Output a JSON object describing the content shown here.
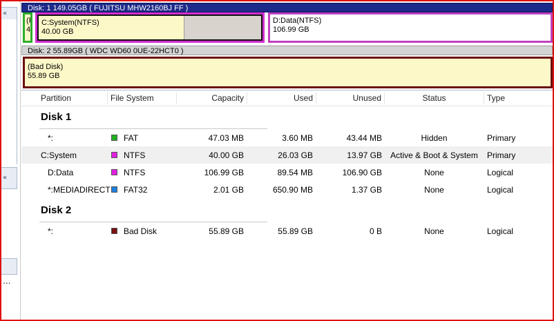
{
  "disk1": {
    "header": "Disk: 1 149.05GB  ( FUJITSU MHW2160BJ FF )",
    "partitions": {
      "fat": {
        "label": "(F",
        "size": "4"
      },
      "c_system": {
        "label": "C:System(NTFS)",
        "size": "40.00 GB"
      },
      "d_data": {
        "label": "D:Data(NTFS)",
        "size": "106.99 GB"
      }
    }
  },
  "disk2": {
    "header": "Disk: 2 55.89GB  ( WDC WD60 0UE-22HCT0 )",
    "partitions": {
      "bad": {
        "label": "(Bad Disk)",
        "size": "55.89 GB"
      }
    }
  },
  "table": {
    "columns": [
      "Partition",
      "File System",
      "Capacity",
      "Used",
      "Unused",
      "Status",
      "Type"
    ],
    "groups": [
      {
        "title": "Disk 1",
        "rows": [
          {
            "partition": "*:",
            "fs": "FAT",
            "color": "#22b022",
            "capacity": "47.03 MB",
            "used": "3.60 MB",
            "unused": "43.44 MB",
            "status": "Hidden",
            "type": "Primary"
          },
          {
            "partition": "C:System",
            "fs": "NTFS",
            "color": "#e020e0",
            "capacity": "40.00 GB",
            "used": "26.03 GB",
            "unused": "13.97 GB",
            "status": "Active & Boot & System",
            "type": "Primary"
          },
          {
            "partition": "D:Data",
            "fs": "NTFS",
            "color": "#e020e0",
            "capacity": "106.99 GB",
            "used": "89.54 MB",
            "unused": "106.90 GB",
            "status": "None",
            "type": "Logical"
          },
          {
            "partition": "*:MEDIADIRECT",
            "fs": "FAT32",
            "color": "#2080e0",
            "capacity": "2.01 GB",
            "used": "650.90 MB",
            "unused": "1.37 GB",
            "status": "None",
            "type": "Logical"
          }
        ]
      },
      {
        "title": "Disk 2",
        "rows": [
          {
            "partition": "*:",
            "fs": "Bad Disk",
            "color": "#7a1010",
            "capacity": "55.89 GB",
            "used": "55.89 GB",
            "unused": "0 B",
            "status": "None",
            "type": "Logical"
          }
        ]
      }
    ]
  },
  "sidebar": {
    "dots": "..."
  }
}
